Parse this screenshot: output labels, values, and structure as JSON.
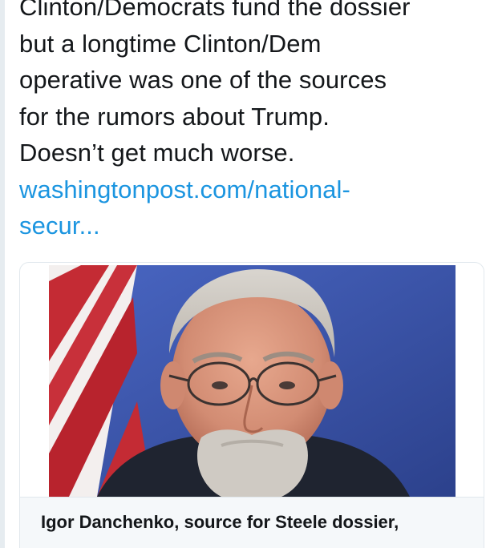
{
  "tweet": {
    "lines": [
      "Clinton/Democrats fund the dossier",
      "but a longtime Clinton/Dem",
      "operative was one of the sources",
      "for the rumors about Trump.",
      "Doesn’t get much worse."
    ],
    "link_line_1": "washingtonpost.com/national-",
    "link_line_2": "secur..."
  },
  "card": {
    "image_description_icon": "photo-icon",
    "title": "Igor Danchenko, source for Steele dossier,",
    "title_cont": ""
  },
  "colors": {
    "text": "#14171a",
    "link": "#1b95e0",
    "card_border": "#e1e8ed",
    "card_footer": "#f5f8fa"
  }
}
